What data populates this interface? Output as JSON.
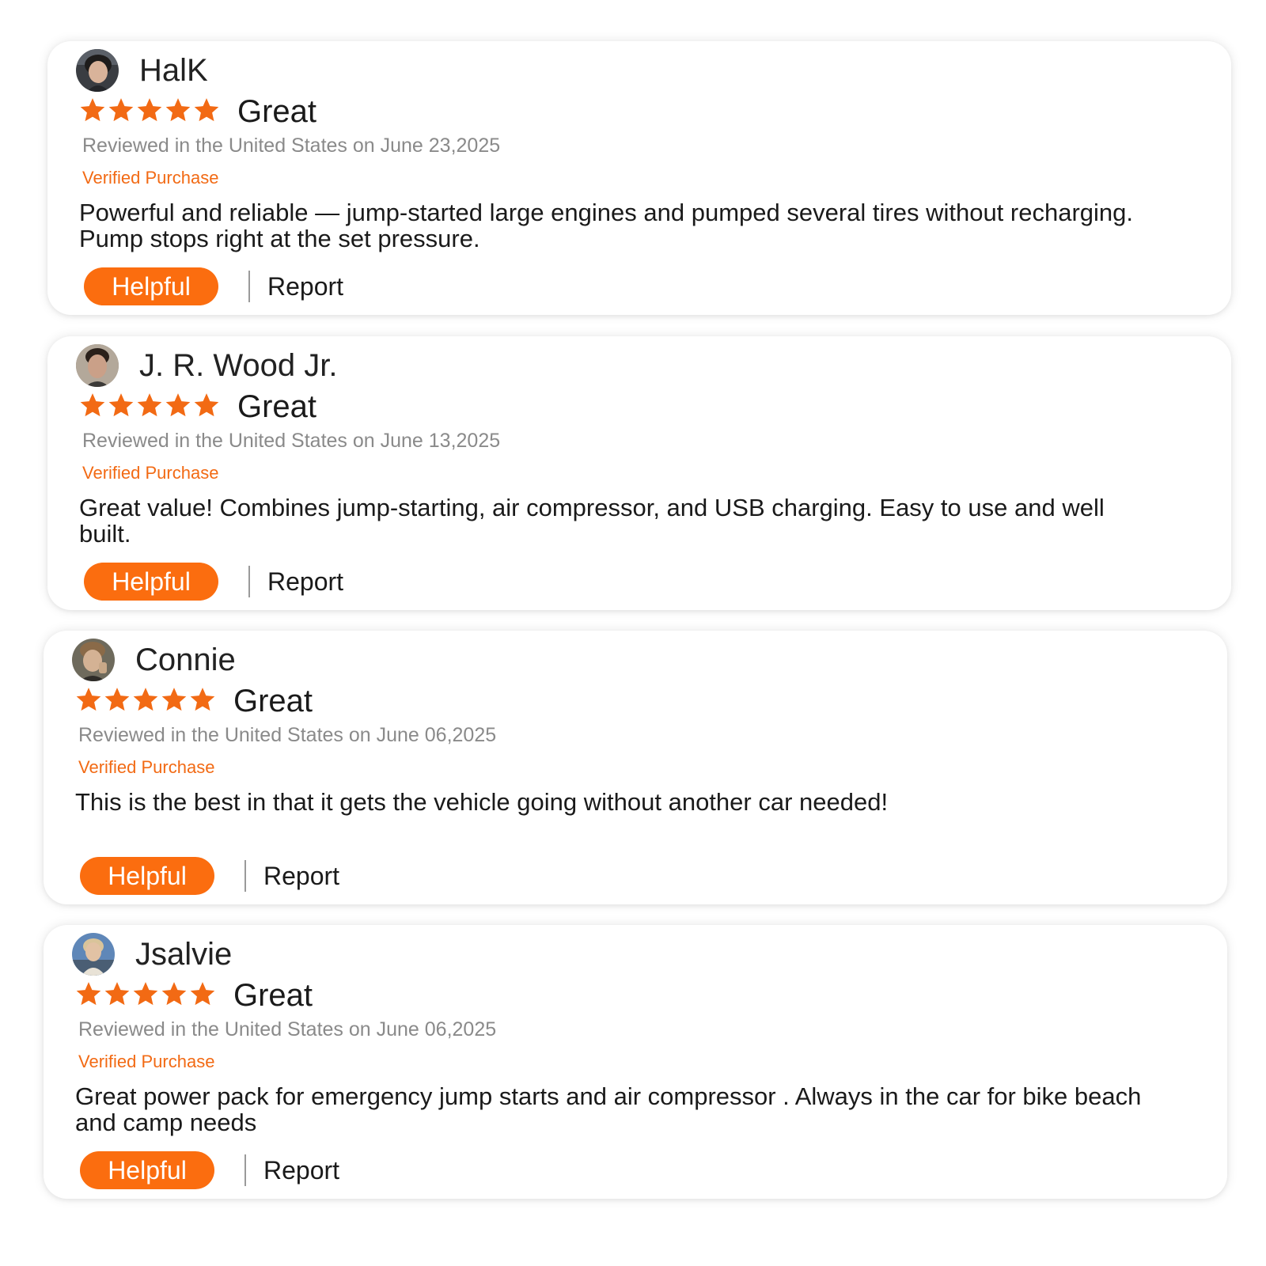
{
  "accent_color": "#fb6d0f",
  "star_color": "#f26a14",
  "reviews": [
    {
      "reviewer": "HalK",
      "avatar_icon": "reviewer-avatar-photo",
      "stars": 5,
      "headline": "Great",
      "meta": "Reviewed in the United States on June 23,2025",
      "verified": "Verified Purchase",
      "body": "Powerful and reliable — jump-started large engines and pumped several tires without recharging. Pump stops right at the set pressure.",
      "helpful_label": "Helpful",
      "report_label": "Report"
    },
    {
      "reviewer": "J. R. Wood Jr.",
      "avatar_icon": "reviewer-avatar-photo",
      "stars": 5,
      "headline": "Great",
      "meta": "Reviewed in the United States on June 13,2025",
      "verified": "Verified Purchase",
      "body": "Great value! Combines jump-starting, air compressor, and USB charging. Easy to use and well built.",
      "helpful_label": "Helpful",
      "report_label": "Report"
    },
    {
      "reviewer": "Connie",
      "avatar_icon": "reviewer-avatar-photo",
      "stars": 5,
      "headline": "Great",
      "meta": "Reviewed in the United States on June 06,2025",
      "verified": "Verified Purchase",
      "body": "This is the best in that it gets the vehicle going without another car needed!",
      "helpful_label": "Helpful",
      "report_label": "Report"
    },
    {
      "reviewer": "Jsalvie",
      "avatar_icon": "reviewer-avatar-photo",
      "stars": 5,
      "headline": "Great",
      "meta": "Reviewed in the United States on June 06,2025",
      "verified": "Verified Purchase",
      "body": "Great power pack for emergency jump starts and air compressor . Always in the car for bike beach and camp needs",
      "helpful_label": "Helpful",
      "report_label": "Report"
    }
  ]
}
